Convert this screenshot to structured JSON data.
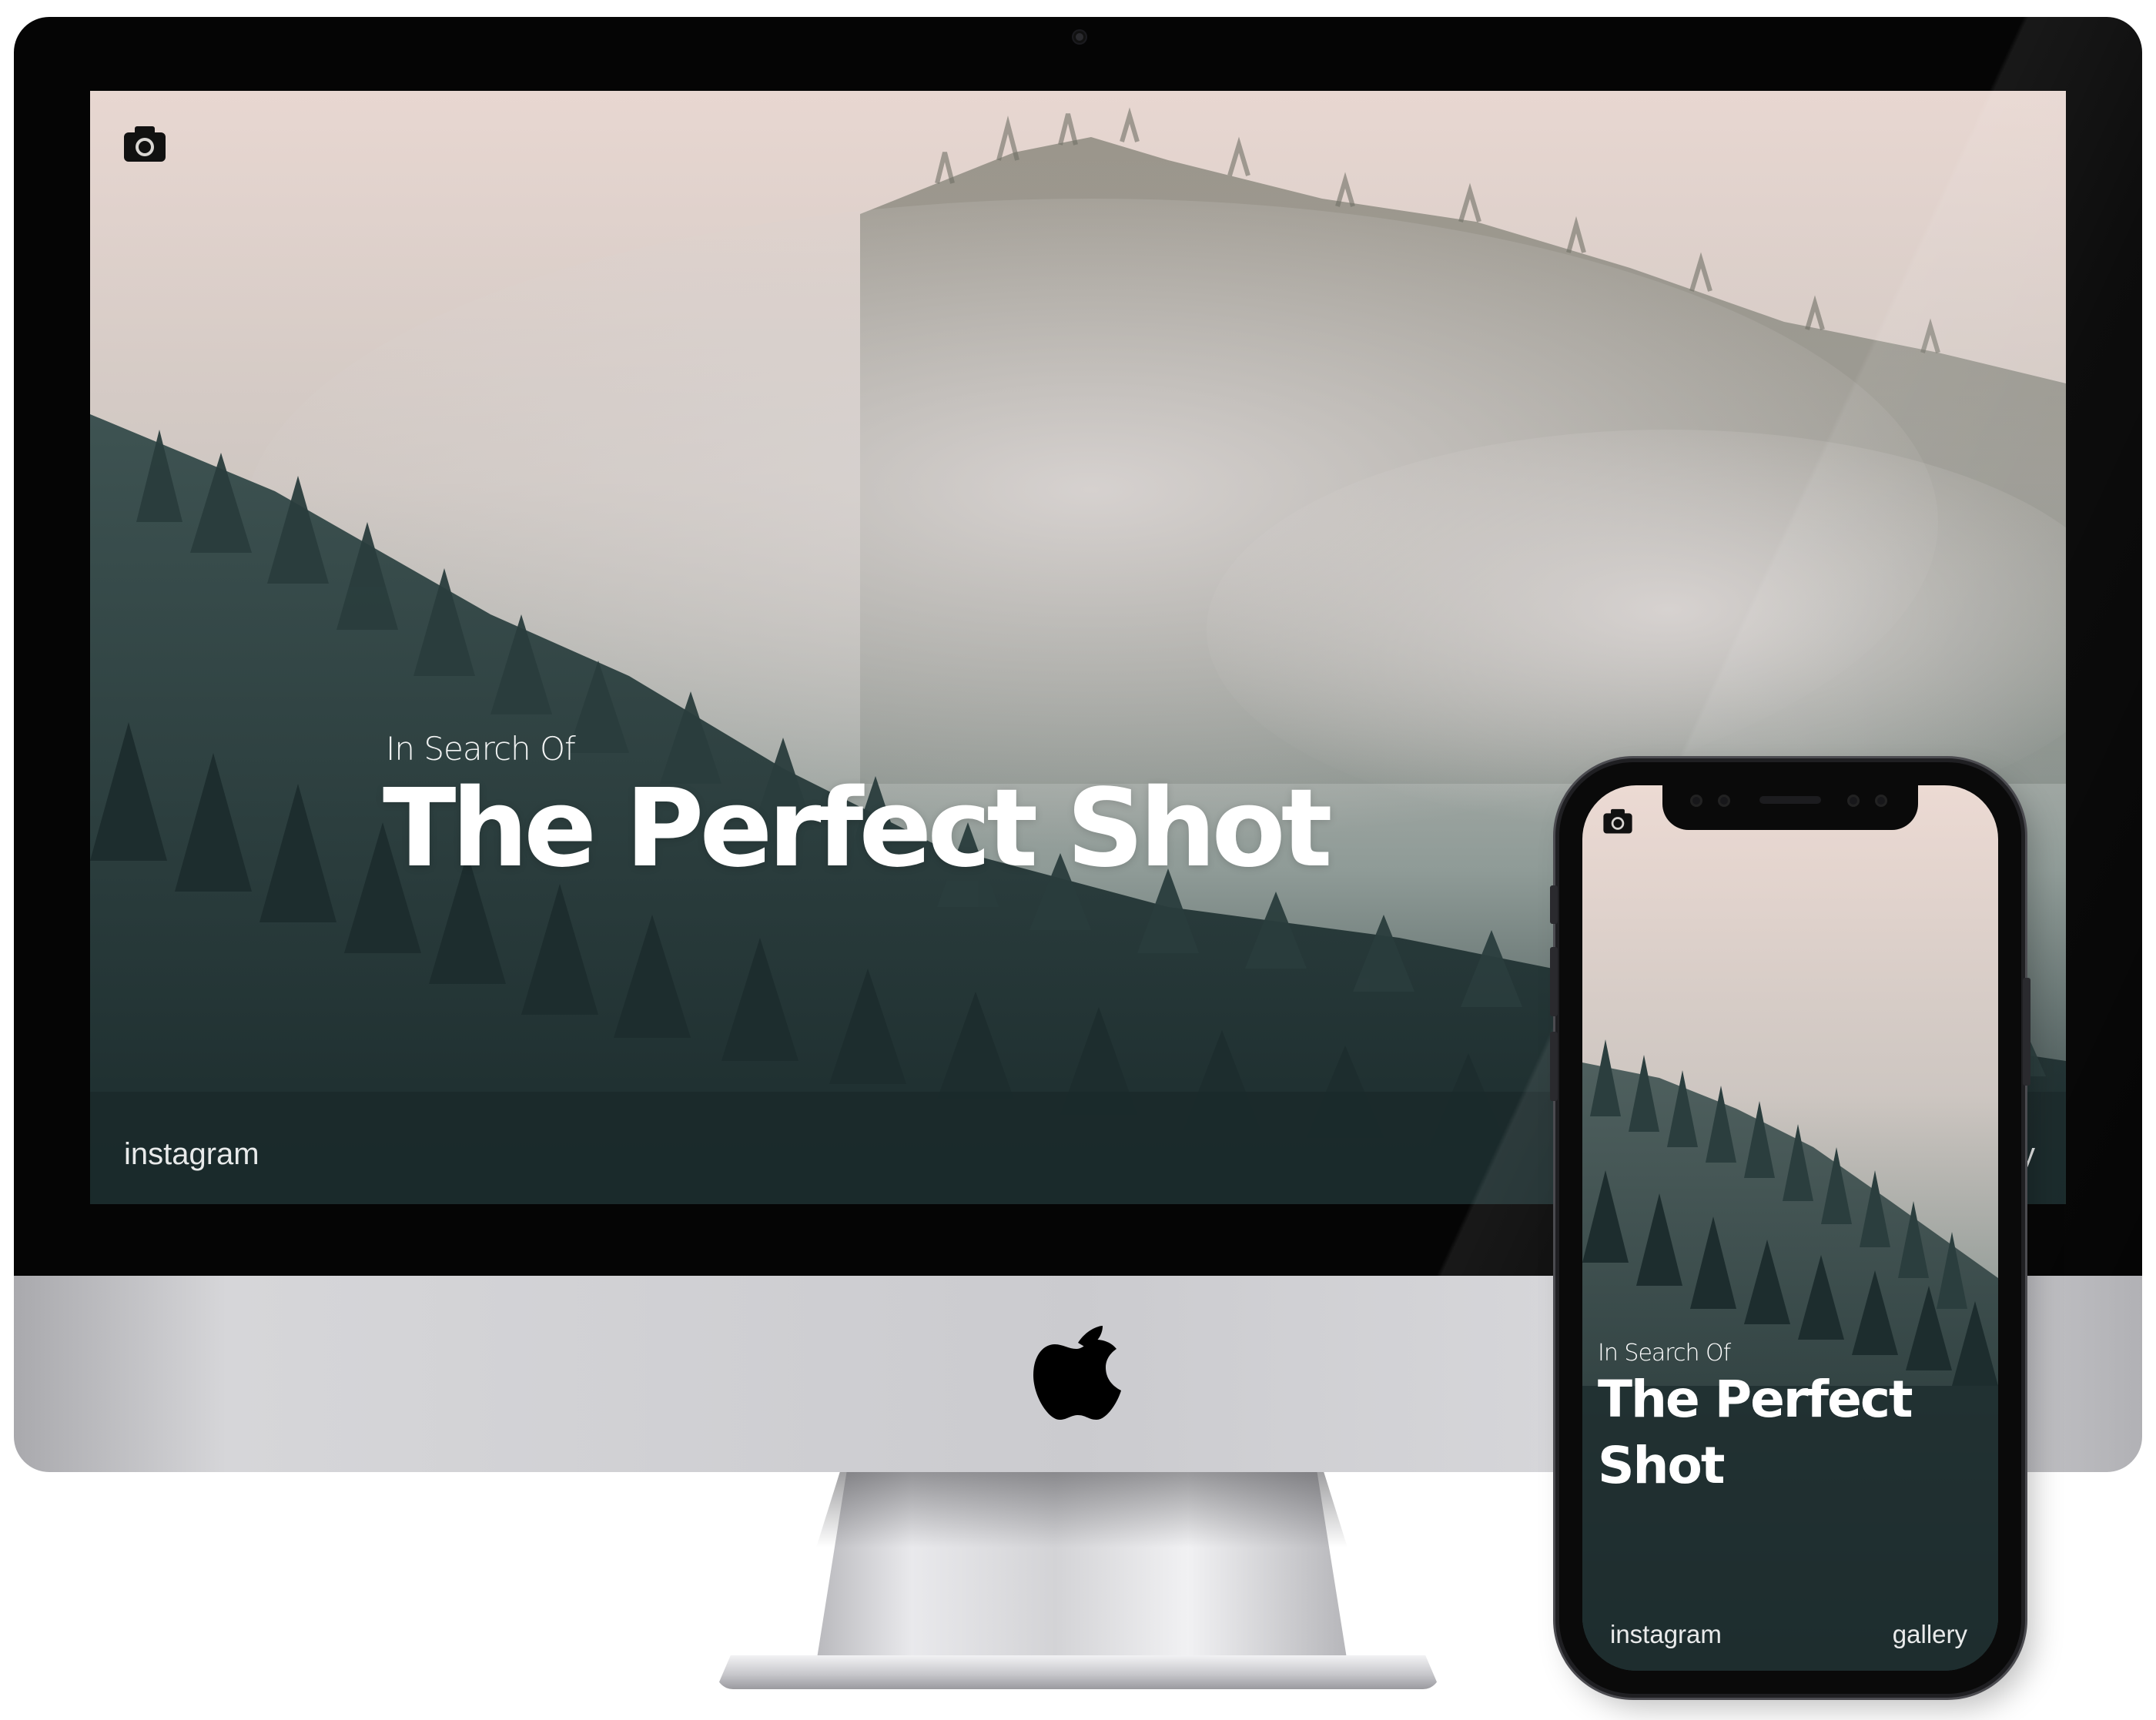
{
  "site": {
    "brand_icon": "camera-icon",
    "hero": {
      "kicker": "In Search Of",
      "title": "The Perfect Shot"
    },
    "footer": {
      "left_link": "instagram",
      "right_link": "gallery"
    }
  },
  "mobile": {
    "brand_icon": "camera-icon",
    "hero": {
      "kicker": "In Search Of",
      "title": "The Perfect Shot"
    },
    "footer": {
      "left_link": "instagram",
      "right_link": "gallery"
    }
  },
  "colors": {
    "hero_text": "#ffffff",
    "sky_top": "#ecd9d2",
    "fog": "#c9c3bf",
    "forest_dark": "#1f2f30",
    "forest_mid": "#3f5350"
  }
}
